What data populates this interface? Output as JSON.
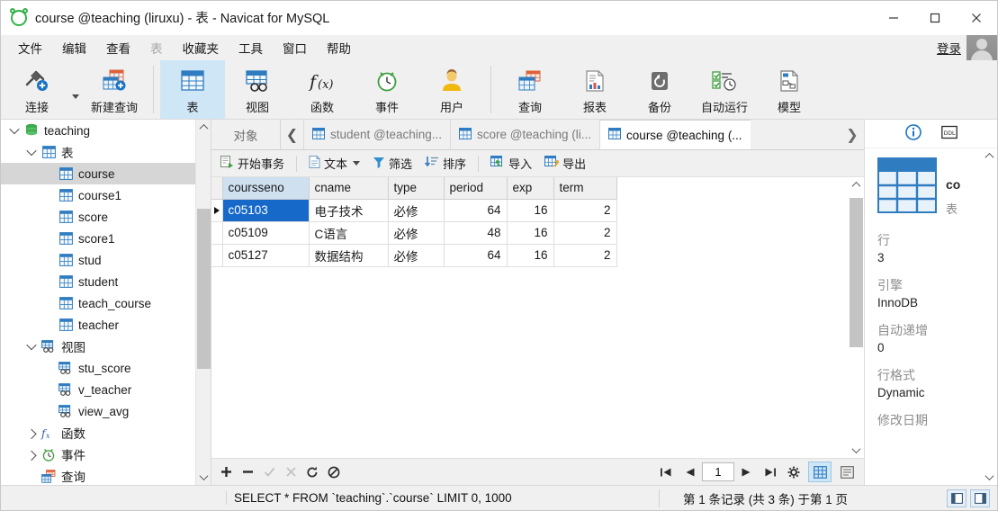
{
  "window": {
    "title": "course @teaching (liruxu) - 表 - Navicat for MySQL",
    "logo_icon": "navicat-logo-icon",
    "minimize_label": "–",
    "maximize_label": "□",
    "close_label": "✕"
  },
  "menubar": {
    "items": [
      {
        "label": "文件",
        "disabled": false
      },
      {
        "label": "编辑",
        "disabled": false
      },
      {
        "label": "查看",
        "disabled": false
      },
      {
        "label": "表",
        "disabled": true
      },
      {
        "label": "收藏夹",
        "disabled": false
      },
      {
        "label": "工具",
        "disabled": false
      },
      {
        "label": "窗口",
        "disabled": false
      },
      {
        "label": "帮助",
        "disabled": false
      }
    ],
    "login_label": "登录",
    "avatar_icon": "user-avatar-icon"
  },
  "toolbar": {
    "items": [
      {
        "label": "连接",
        "icon": "connection-icon",
        "selected": false,
        "has_caret": true
      },
      {
        "label": "新建查询",
        "icon": "new-query-icon",
        "selected": false,
        "has_caret": false
      },
      {
        "label": "表",
        "icon": "table-icon",
        "selected": true,
        "has_caret": false
      },
      {
        "label": "视图",
        "icon": "view-icon",
        "selected": false,
        "has_caret": false
      },
      {
        "label": "函数",
        "icon": "function-fx-icon",
        "selected": false,
        "has_caret": false
      },
      {
        "label": "事件",
        "icon": "event-clock-icon",
        "selected": false,
        "has_caret": false
      },
      {
        "label": "用户",
        "icon": "user-icon",
        "selected": false,
        "has_caret": false
      },
      {
        "label": "查询",
        "icon": "query-icon",
        "selected": false,
        "has_caret": false
      },
      {
        "label": "报表",
        "icon": "report-icon",
        "selected": false,
        "has_caret": false
      },
      {
        "label": "备份",
        "icon": "backup-icon",
        "selected": false,
        "has_caret": false
      },
      {
        "label": "自动运行",
        "icon": "automation-icon",
        "selected": false,
        "has_caret": false
      },
      {
        "label": "模型",
        "icon": "model-icon",
        "selected": false,
        "has_caret": false
      }
    ]
  },
  "sidebar": {
    "nodes": [
      {
        "label": "teaching",
        "indent": 0,
        "icon": "database-icon",
        "expander": "down",
        "selected": false
      },
      {
        "label": "表",
        "indent": 1,
        "icon": "table-folder-icon",
        "expander": "down",
        "selected": false
      },
      {
        "label": "course",
        "indent": 2,
        "icon": "table-icon",
        "expander": "none",
        "selected": true
      },
      {
        "label": "course1",
        "indent": 2,
        "icon": "table-icon",
        "expander": "none",
        "selected": false
      },
      {
        "label": "score",
        "indent": 2,
        "icon": "table-icon",
        "expander": "none",
        "selected": false
      },
      {
        "label": "score1",
        "indent": 2,
        "icon": "table-icon",
        "expander": "none",
        "selected": false
      },
      {
        "label": "stud",
        "indent": 2,
        "icon": "table-icon",
        "expander": "none",
        "selected": false
      },
      {
        "label": "student",
        "indent": 2,
        "icon": "table-icon",
        "expander": "none",
        "selected": false
      },
      {
        "label": "teach_course",
        "indent": 2,
        "icon": "table-icon",
        "expander": "none",
        "selected": false
      },
      {
        "label": "teacher",
        "indent": 2,
        "icon": "table-icon",
        "expander": "none",
        "selected": false
      },
      {
        "label": "视图",
        "indent": 1,
        "icon": "view-icon",
        "expander": "down",
        "selected": false
      },
      {
        "label": "stu_score",
        "indent": 2,
        "icon": "view-icon",
        "expander": "none",
        "selected": false
      },
      {
        "label": "v_teacher",
        "indent": 2,
        "icon": "view-icon",
        "expander": "none",
        "selected": false
      },
      {
        "label": "view_avg",
        "indent": 2,
        "icon": "view-icon",
        "expander": "none",
        "selected": false
      },
      {
        "label": "函数",
        "indent": 1,
        "icon": "function-fx-icon",
        "expander": "right",
        "selected": false
      },
      {
        "label": "事件",
        "indent": 1,
        "icon": "event-clock-icon",
        "expander": "right",
        "selected": false
      },
      {
        "label": "查询",
        "indent": 1,
        "icon": "query-icon",
        "expander": "none",
        "selected": false
      }
    ]
  },
  "tabs": {
    "objects_label": "对象",
    "prev_icon": "chevron-left-icon",
    "next_icon": "chevron-right-icon",
    "items": [
      {
        "label": "student @teaching...",
        "icon": "table-icon",
        "active": false
      },
      {
        "label": "score @teaching (li...",
        "icon": "table-icon",
        "active": false
      },
      {
        "label": "course @teaching (...",
        "icon": "table-icon",
        "active": true
      }
    ]
  },
  "data_toolbar": {
    "items": [
      {
        "label": "开始事务",
        "icon": "transaction-icon",
        "caret": false
      },
      {
        "label": "文本",
        "icon": "text-icon",
        "caret": true
      },
      {
        "label": "筛选",
        "icon": "filter-icon",
        "caret": false
      },
      {
        "label": "排序",
        "icon": "sort-icon",
        "caret": false
      },
      {
        "label": "导入",
        "icon": "import-icon",
        "caret": false
      },
      {
        "label": "导出",
        "icon": "export-icon",
        "caret": false
      }
    ]
  },
  "grid": {
    "columns": [
      "coursseno",
      "cname",
      "type",
      "period",
      "exp",
      "term"
    ],
    "column_headers": [
      "coursseno",
      "cname",
      "type",
      "period",
      "exp",
      "term"
    ],
    "rows": [
      {
        "coursseno": "c05103",
        "cname": "电子技术",
        "type": "必修",
        "period": "64",
        "exp": "16",
        "term": "2",
        "current": true
      },
      {
        "coursseno": "c05109",
        "cname": "C语言",
        "type": "必修",
        "period": "48",
        "exp": "16",
        "term": "2",
        "current": false
      },
      {
        "coursseno": "c05127",
        "cname": "数据结构",
        "type": "必修",
        "period": "64",
        "exp": "16",
        "term": "2",
        "current": false
      }
    ],
    "selected_cell": {
      "row": 0,
      "column": "coursseno"
    }
  },
  "record_nav": {
    "buttons": [
      {
        "icon": "add-record-icon",
        "glyph": "✚",
        "disabled": false
      },
      {
        "icon": "delete-record-icon",
        "glyph": "━",
        "disabled": false
      },
      {
        "icon": "apply-change-icon",
        "glyph": "✓",
        "disabled": true
      },
      {
        "icon": "cancel-change-icon",
        "glyph": "✕",
        "disabled": true
      },
      {
        "icon": "refresh-icon",
        "glyph": "⟳",
        "disabled": false
      },
      {
        "icon": "stop-icon",
        "glyph": "⊘",
        "disabled": false
      }
    ],
    "first_icon": "first-page-icon",
    "prev_icon": "prev-page-icon",
    "page_value": "1",
    "next_icon": "next-page-icon",
    "last_icon": "last-page-icon",
    "settings_icon": "gear-icon",
    "grid_view_icon": "grid-view-icon",
    "form_view_icon": "form-view-icon"
  },
  "info_panel": {
    "info_icon": "info-circle-icon",
    "ddl_icon": "ddl-icon",
    "object_icon": "table-large-icon",
    "object_name": "co",
    "object_kind": "表",
    "properties": [
      {
        "key": "行",
        "value": "3"
      },
      {
        "key": "引擎",
        "value": "InnoDB"
      },
      {
        "key": "自动递增",
        "value": "0"
      },
      {
        "key": "行格式",
        "value": "Dynamic"
      },
      {
        "key": "修改日期",
        "value": ""
      }
    ]
  },
  "statusbar": {
    "sql": "SELECT * FROM `teaching`.`course` LIMIT 0, 1000",
    "record_info": "第 1 条记录 (共 3 条) 于第 1 页",
    "left_panel_toggle_icon": "toggle-left-panel-icon",
    "right_panel_toggle_icon": "toggle-right-panel-icon"
  },
  "colors": {
    "accent_blue": "#1668c9",
    "header_key_blue": "#cfe0f7",
    "toolbar_selected": "#cfe6f7",
    "tree_selected": "#d6d6d6",
    "logo_green": "#35b14a"
  }
}
